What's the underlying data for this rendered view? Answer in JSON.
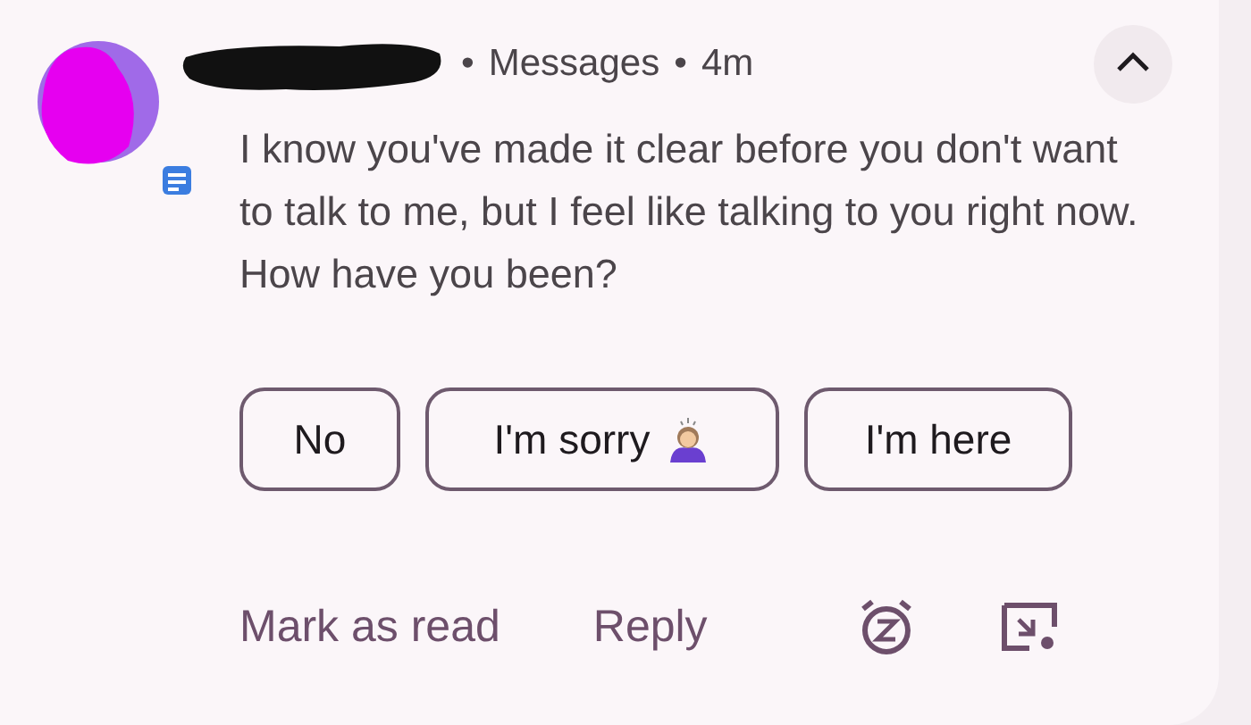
{
  "notification": {
    "app": "Messages",
    "time": "4m",
    "separator": "•",
    "expanded": true,
    "message": "I know you've made it clear before you don't want to talk to me, but I feel like talking to you right now. How have you been?",
    "smart_replies": [
      {
        "label": "No",
        "kind": "text"
      },
      {
        "label": "I'm sorry",
        "kind": "emoji"
      },
      {
        "label": "I'm here",
        "kind": "text"
      }
    ],
    "actions": [
      "Mark as read",
      "Reply"
    ]
  }
}
